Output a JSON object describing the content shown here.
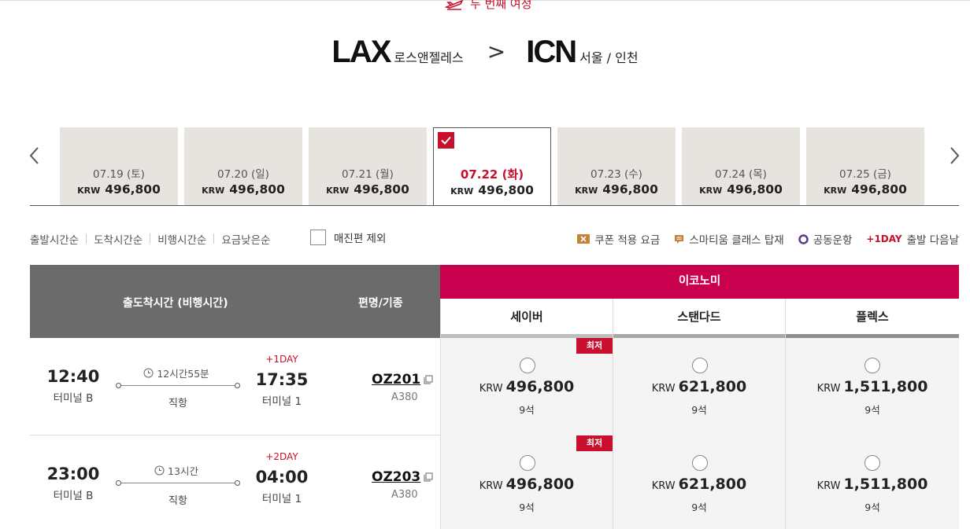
{
  "trip_label": "두 번째 여정",
  "route": {
    "origin_code": "LAX",
    "origin_city": "로스앤젤레스",
    "arrow": ">",
    "dest_code": "ICN",
    "dest_city": "서울 / 인천"
  },
  "dates": [
    {
      "date": "07.19 (토)",
      "currency": "KRW",
      "price": "496,800",
      "active": false
    },
    {
      "date": "07.20 (일)",
      "currency": "KRW",
      "price": "496,800",
      "active": false
    },
    {
      "date": "07.21 (월)",
      "currency": "KRW",
      "price": "496,800",
      "active": false
    },
    {
      "date": "07.22 (화)",
      "currency": "KRW",
      "price": "496,800",
      "active": true
    },
    {
      "date": "07.23 (수)",
      "currency": "KRW",
      "price": "496,800",
      "active": false
    },
    {
      "date": "07.24 (목)",
      "currency": "KRW",
      "price": "496,800",
      "active": false
    },
    {
      "date": "07.25 (금)",
      "currency": "KRW",
      "price": "496,800",
      "active": false
    }
  ],
  "sort_options": [
    "출발시간순",
    "도착시간순",
    "비행시간순",
    "요금낮은순"
  ],
  "exclude_soldout": "매진편 제외",
  "legend": {
    "coupon": "쿠폰 적용 요금",
    "smartium": "스마티움 클래스 탑재",
    "codeshare": "공동운항",
    "oneday_tag": "+1DAY",
    "oneday_text": "출발 다음날"
  },
  "table": {
    "col_time": "출도착시간 (비행시간)",
    "col_flight": "편명/기종",
    "cabin": "이코노미",
    "fares": [
      "세이버",
      "스탠다드",
      "플렉스"
    ],
    "fare_bar_colors": [
      "#bdbdbd",
      "#a8a8a8",
      "#8f8f8f"
    ],
    "lowest_badge": "최저"
  },
  "flights": [
    {
      "dep_time": "12:40",
      "dep_terminal": "터미널 B",
      "duration": "12시간55분",
      "direct": "직항",
      "plus_day": "+1DAY",
      "arr_time": "17:35",
      "arr_terminal": "터미널 1",
      "flight_no": "OZ201",
      "aircraft": "A380",
      "fares": [
        {
          "currency": "KRW",
          "price": "496,800",
          "seats": "9석",
          "lowest": true
        },
        {
          "currency": "KRW",
          "price": "621,800",
          "seats": "9석",
          "lowest": false
        },
        {
          "currency": "KRW",
          "price": "1,511,800",
          "seats": "9석",
          "lowest": false
        }
      ]
    },
    {
      "dep_time": "23:00",
      "dep_terminal": "터미널 B",
      "duration": "13시간",
      "direct": "직항",
      "plus_day": "+2DAY",
      "arr_time": "04:00",
      "arr_terminal": "터미널 1",
      "flight_no": "OZ203",
      "aircraft": "A380",
      "fares": [
        {
          "currency": "KRW",
          "price": "496,800",
          "seats": "9석",
          "lowest": true
        },
        {
          "currency": "KRW",
          "price": "621,800",
          "seats": "9석",
          "lowest": false
        },
        {
          "currency": "KRW",
          "price": "1,511,800",
          "seats": "9석",
          "lowest": false
        }
      ]
    }
  ],
  "colors": {
    "accent": "#c8102e",
    "cabin_header": "#c8004e",
    "table_head": "#6b6b6b"
  }
}
